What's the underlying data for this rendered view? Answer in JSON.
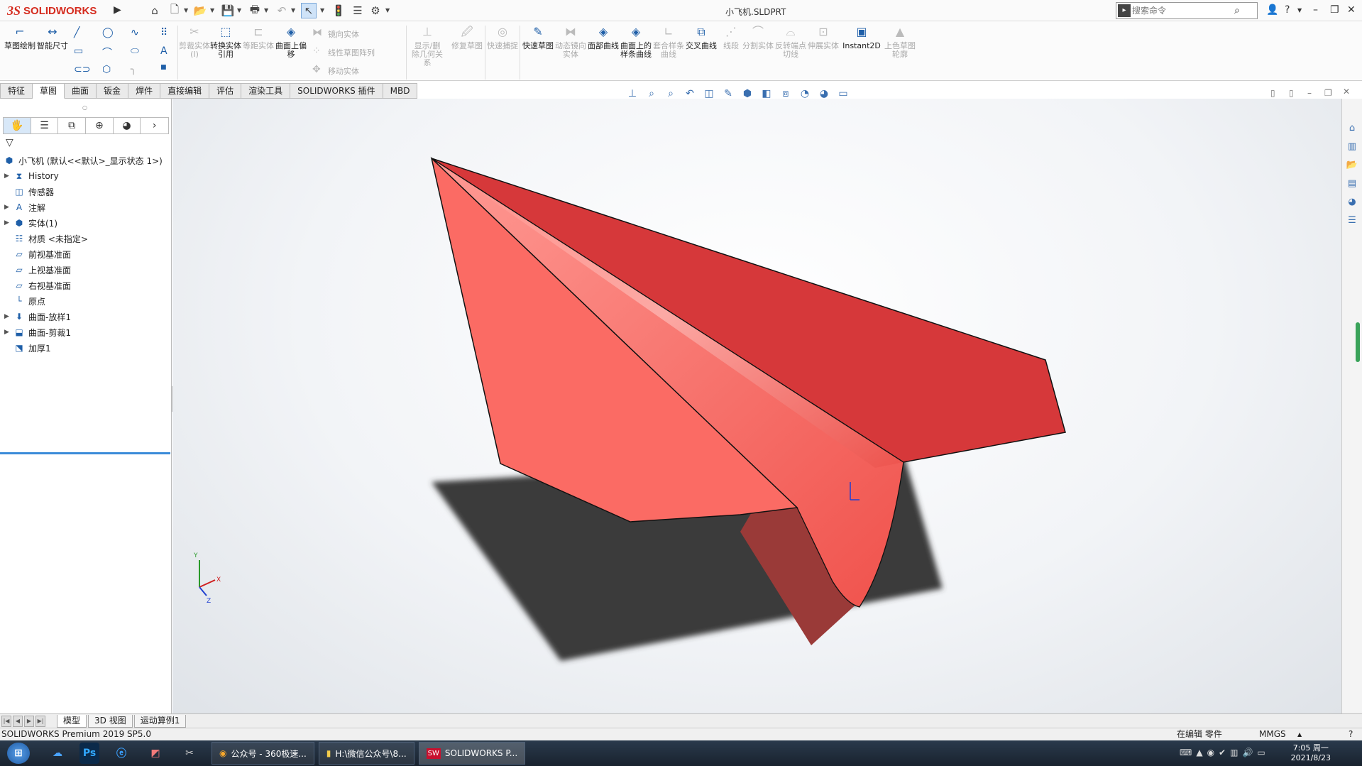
{
  "app": {
    "brand_mark": "3S",
    "brand": "SOLIDWORKS",
    "doc_title": "小飞机.SLDPRT",
    "search_placeholder": "搜索命令"
  },
  "quick_access": {
    "home": "home-icon",
    "new": "new-icon",
    "open": "open-icon",
    "save": "save-icon",
    "print": "print-icon",
    "undo": "undo-icon",
    "select": "select-icon",
    "rebuild": "rebuild-icon",
    "file_props": "file-props-icon",
    "options": "gear-icon"
  },
  "ribbon": {
    "sketch": "草图绘制",
    "smart_dim": "智能尺寸",
    "trim": "剪裁实体(I)",
    "convert": "转换实体引用",
    "offset": "等距实体",
    "surface_offset": "曲面上偏移",
    "mirror": "镜向实体",
    "linear_pattern": "线性草图阵列",
    "move": "移动实体",
    "show_relations": "显示/删除几何关系",
    "repair": "修复草图",
    "quick_snap": "快速捕捉",
    "rapid_sketch": "快速草图",
    "instant_mirror": "动态镜向实体",
    "face_curve": "面部曲线",
    "spline_on_surface": "曲面上的样条曲线",
    "fit_spline": "套合样条曲线",
    "intersection": "交叉曲线",
    "segment": "线段",
    "split": "分割实体",
    "reverse_tangent": "反转端点切线",
    "stretch": "伸展实体",
    "instant2d": "Instant2D",
    "shaded_contours": "上色草图轮廓"
  },
  "tabs": [
    "特征",
    "草图",
    "曲面",
    "钣金",
    "焊件",
    "直接编辑",
    "评估",
    "渲染工具",
    "SOLIDWORKS 插件",
    "MBD"
  ],
  "active_tab": 1,
  "tree": {
    "root": "小飞机  (默认<<默认>_显示状态 1>)",
    "items": [
      {
        "label": "History",
        "icon": "history-icon",
        "expandable": true
      },
      {
        "label": "传感器",
        "icon": "sensor-icon",
        "expandable": false
      },
      {
        "label": "注解",
        "icon": "annotation-icon",
        "expandable": true
      },
      {
        "label": "实体(1)",
        "icon": "solid-body-icon",
        "expandable": true
      },
      {
        "label": "材质 <未指定>",
        "icon": "material-icon",
        "expandable": false
      },
      {
        "label": "前视基准面",
        "icon": "plane-icon",
        "expandable": false
      },
      {
        "label": "上视基准面",
        "icon": "plane-icon",
        "expandable": false
      },
      {
        "label": "右视基准面",
        "icon": "plane-icon",
        "expandable": false
      },
      {
        "label": "原点",
        "icon": "origin-icon",
        "expandable": false
      },
      {
        "label": "曲面-放样1",
        "icon": "loft-icon",
        "expandable": true
      },
      {
        "label": "曲面-剪裁1",
        "icon": "surface-trim-icon",
        "expandable": true
      },
      {
        "label": "加厚1",
        "icon": "thicken-icon",
        "expandable": false
      }
    ]
  },
  "bottom_tabs": [
    "模型",
    "3D 视图",
    "运动算例1"
  ],
  "status": {
    "left": "SOLIDWORKS Premium 2019 SP5.0",
    "mode": "在编辑 零件",
    "units": "MMGS"
  },
  "taskbar": {
    "items": [
      "公众号 - 360极速...",
      "H:\\微信公众号\\8...",
      "SOLIDWORKS P..."
    ],
    "time": "7:05 周一",
    "date": "2021/8/23"
  },
  "colors": {
    "model_red": "#e0453f",
    "model_dark": "#c93430",
    "accent_blue": "#3a8bd8"
  }
}
